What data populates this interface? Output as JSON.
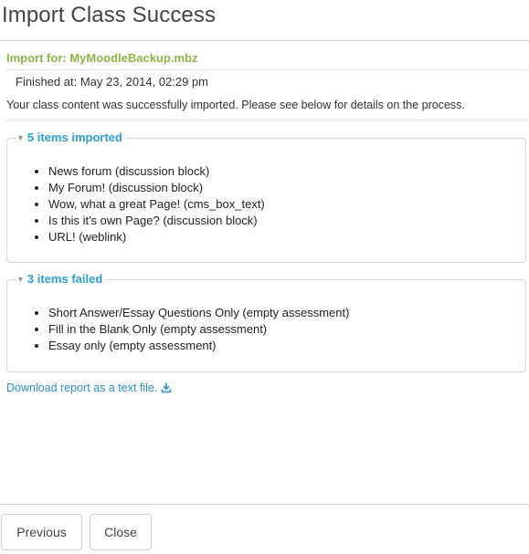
{
  "dialog": {
    "title": "Import Class Success"
  },
  "import_info": {
    "import_for": "Import for: MyMoodleBackup.mbz",
    "finished_at": "Finished at: May 23, 2014, 02:29 pm",
    "description": "Your class content was successfully imported. Please see below for details on the process."
  },
  "imported": {
    "legend": "5 items imported",
    "items": [
      "News forum (discussion block)",
      "My Forum! (discussion block)",
      "Wow, what a great Page! (cms_box_text)",
      "Is this it's own Page? (discussion block)",
      "URL! (weblink)"
    ]
  },
  "failed": {
    "legend": "3 items failed",
    "items": [
      "Short Answer/Essay Questions Only (empty assessment)",
      "Fill in the Blank Only (empty assessment)",
      "Essay only (empty assessment)"
    ]
  },
  "download": {
    "label": "Download report as a text file.",
    "icon": "download-icon"
  },
  "footer": {
    "previous_label": "Previous",
    "close_label": "Close"
  },
  "colors": {
    "accent_green": "#8db547",
    "link_blue": "#2b9ed4"
  }
}
